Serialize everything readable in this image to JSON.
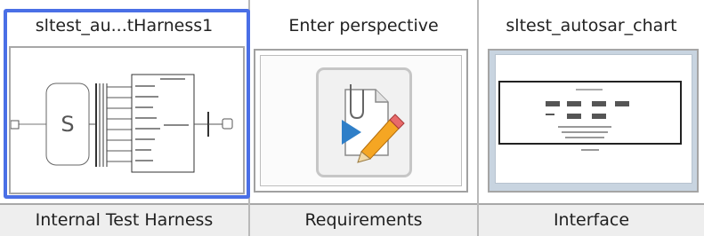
{
  "tiles": [
    {
      "title": "sltest_au...tHarness1",
      "label": "Internal Test Harness",
      "thumbnail": "test-harness-diagram",
      "selected": true
    },
    {
      "title": "Enter perspective",
      "label": "Requirements",
      "thumbnail": "requirements-editor-icon",
      "selected": false
    },
    {
      "title": "sltest_autosar_chart",
      "label": "Interface",
      "thumbnail": "autosar-chart-page",
      "selected": false
    }
  ],
  "colors": {
    "selection": "#4a6fe6",
    "label_bar": "#eeeeee",
    "grid_line": "#b9b9b9"
  }
}
